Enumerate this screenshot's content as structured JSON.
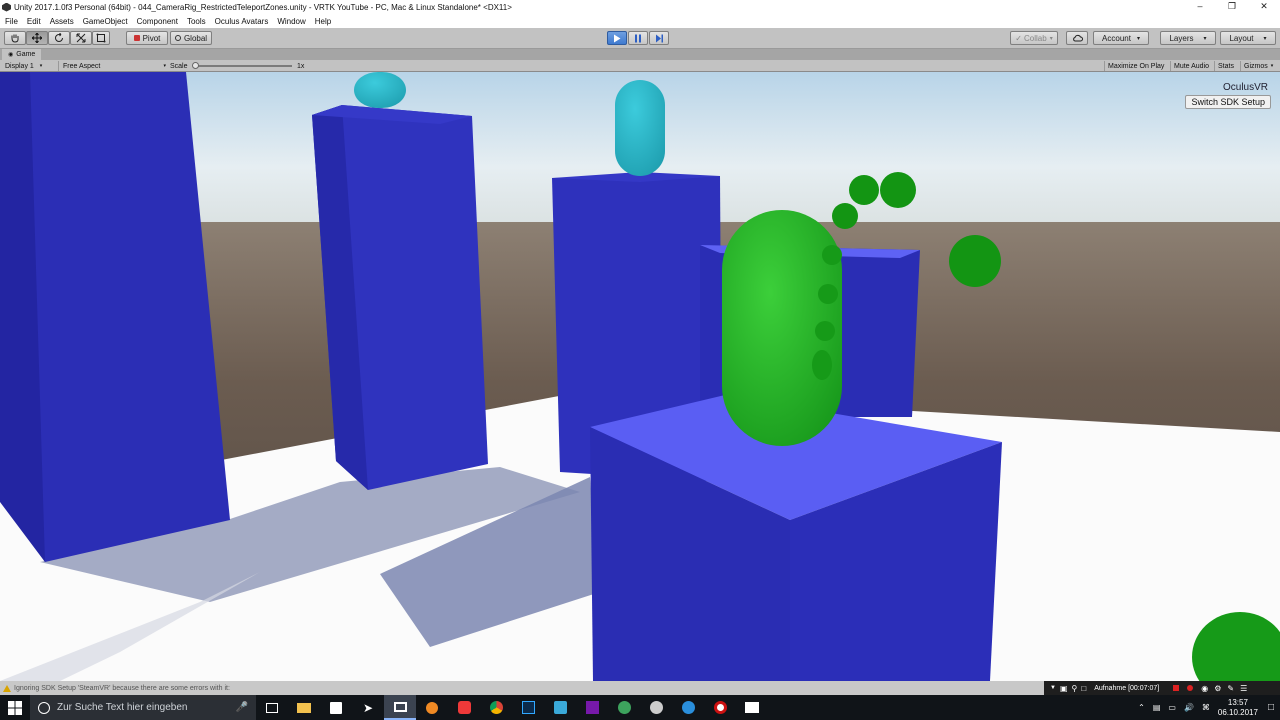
{
  "window": {
    "title": "Unity 2017.1.0f3 Personal (64bit) - 044_CameraRig_RestrictedTeleportZones.unity - VRTK YouTube - PC, Mac & Linux Standalone* <DX11>",
    "min": "–",
    "max": "❐",
    "close": "✕"
  },
  "menu": [
    "File",
    "Edit",
    "Assets",
    "GameObject",
    "Component",
    "Tools",
    "Oculus Avatars",
    "Window",
    "Help"
  ],
  "toolbar": {
    "pivot": "Pivot",
    "global": "Global",
    "collab": "Collab",
    "account": "Account",
    "layers": "Layers",
    "layout": "Layout"
  },
  "game_tab": {
    "label": "Game"
  },
  "gamebar": {
    "display": "Display 1",
    "aspect": "Free Aspect",
    "scale_label": "Scale",
    "scale_value": "1x",
    "maximize": "Maximize On Play",
    "mute": "Mute Audio",
    "stats": "Stats",
    "gizmos": "Gizmos"
  },
  "overlay": {
    "sdk_label": "OculusVR",
    "sdk_button": "Switch SDK Setup"
  },
  "console": {
    "message": "Ignoring SDK Setup 'SteamVR' because there are some errors with it:"
  },
  "recorder": {
    "label": "Aufnahme [00:07:07]"
  },
  "taskbar": {
    "search_placeholder": "Zur Suche Text hier eingeben",
    "time": "13:57",
    "date": "06.10.2017"
  },
  "colors": {
    "pillar": "#2c2fb8",
    "pillar_light": "#5b5ff4",
    "capsule_green": "#22a823",
    "capsule_cyan": "#2bb9cc",
    "sky": "#c9dae6",
    "floor": "#fbfbfb"
  }
}
